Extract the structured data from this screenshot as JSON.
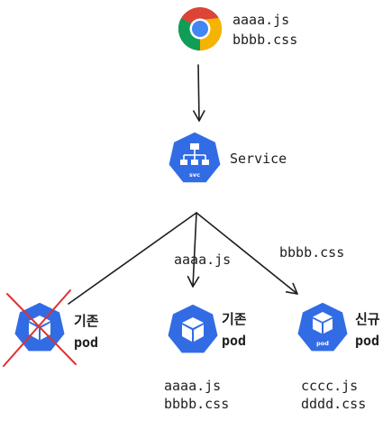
{
  "browser": {
    "files": [
      "aaaa.js",
      "bbbb.css"
    ]
  },
  "service": {
    "badge": "svc",
    "label": "Service"
  },
  "edges": {
    "middle_label": "aaaa.js",
    "right_label": "bbbb.css"
  },
  "pods": [
    {
      "line1": "기존",
      "line2": "pod",
      "crossed_out": true,
      "files": []
    },
    {
      "line1": "기존",
      "line2": "pod",
      "crossed_out": false,
      "files": [
        "aaaa.js",
        "bbbb.css"
      ]
    },
    {
      "line1": "신규",
      "line2": "pod",
      "badge": "pod",
      "crossed_out": false,
      "files": [
        "cccc.js",
        "dddd.css"
      ]
    }
  ],
  "colors": {
    "k8s_blue": "#326ce5",
    "cross_red": "#e03131",
    "ink": "#1e1e1e"
  }
}
